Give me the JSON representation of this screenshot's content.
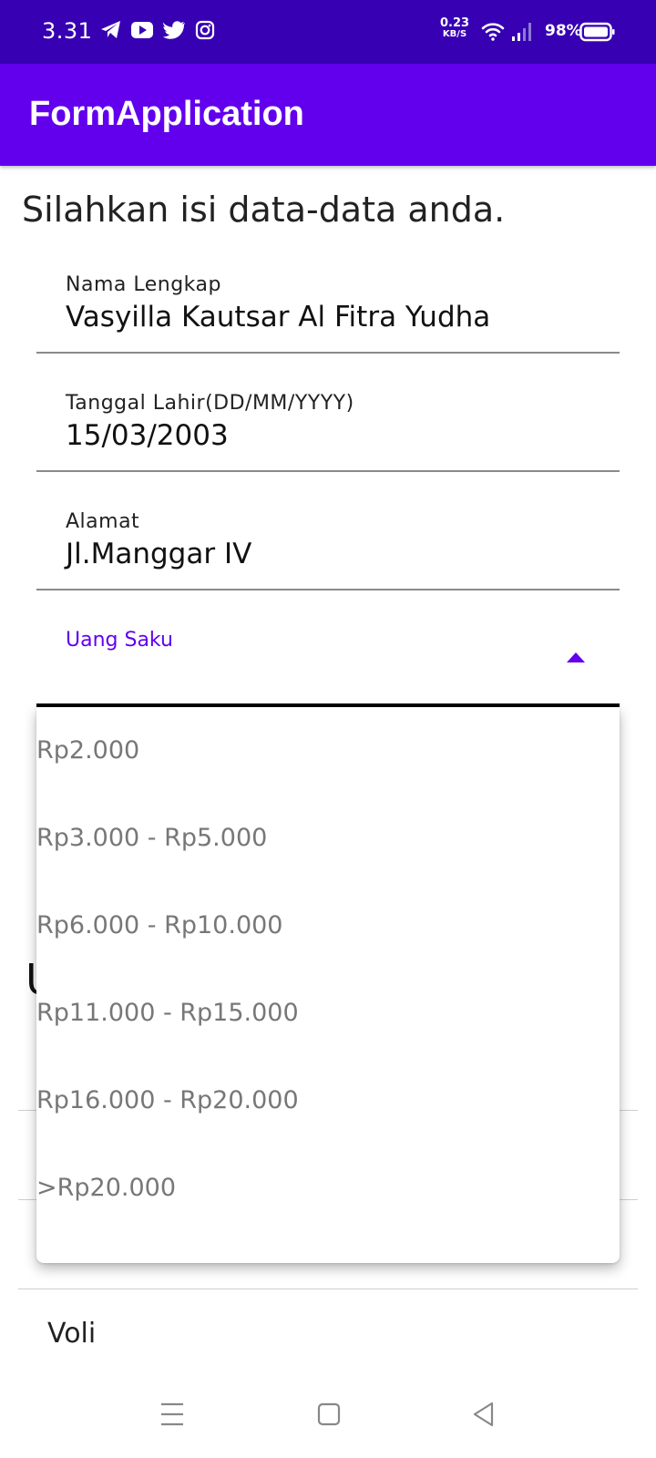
{
  "status_bar": {
    "time": "3.31",
    "net_speed_value": "0.23",
    "net_speed_unit": "KB/S",
    "battery": "98%",
    "notification_icons": [
      "telegram-icon",
      "youtube-icon",
      "twitter-icon",
      "instagram-icon"
    ],
    "system_icons": [
      "wifi-icon",
      "signal-icon",
      "battery-icon"
    ]
  },
  "app_bar": {
    "title": "FormApplication"
  },
  "form": {
    "intro": "Silahkan isi data-data anda.",
    "full_name": {
      "label": "Nama Lengkap",
      "value": "Vasyilla Kautsar Al Fitra Yudha"
    },
    "birth_date": {
      "label": "Tanggal Lahir(DD/MM/YYYY)",
      "value": "15/03/2003"
    },
    "address": {
      "label": "Alamat",
      "value": "Jl.Manggar IV"
    },
    "pocket_money": {
      "label": "Uang Saku",
      "expanded": true,
      "options": [
        "Rp2.000",
        "Rp3.000 - Rp5.000",
        "Rp6.000 - Rp10.000",
        "Rp11.000 - Rp15.000",
        "Rp16.000 - Rp20.000",
        ">Rp20.000"
      ]
    }
  },
  "background": {
    "partial_letter": "U",
    "hobby_item": "Voli"
  },
  "colors": {
    "status_bar": "#3700B3",
    "app_bar": "#6200EE",
    "accent": "#6200EE",
    "dropdown_text": "#777777"
  },
  "nav_bar": {
    "buttons": [
      "menu-icon",
      "home-icon",
      "back-icon"
    ]
  }
}
